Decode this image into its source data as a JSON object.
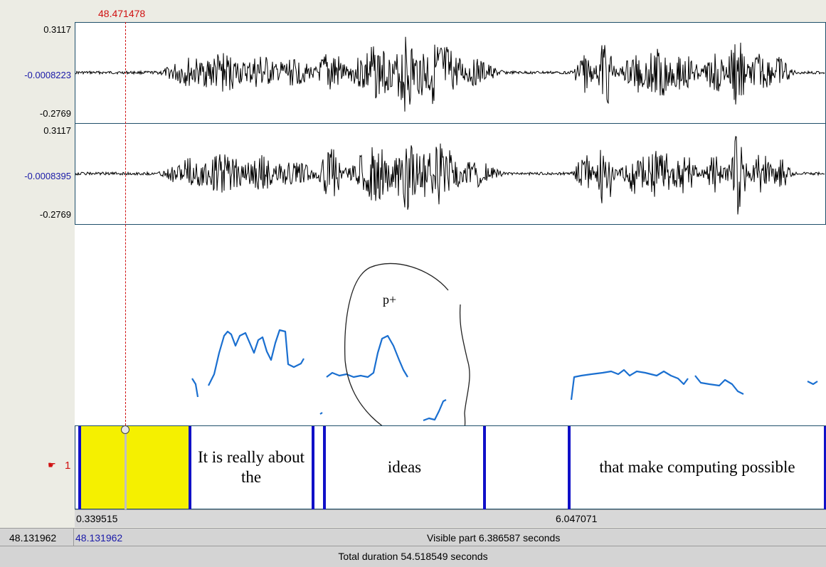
{
  "cursor": {
    "time_label": "48.471478"
  },
  "channels": [
    {
      "max": "0.3117",
      "mid": "-0.0008223",
      "min": "-0.2769"
    },
    {
      "max": "0.3117",
      "mid": "-0.0008395",
      "min": "-0.2769"
    }
  ],
  "pitch": {
    "annotation": "p+"
  },
  "tier": {
    "number": "1",
    "intervals": [
      {
        "text": ""
      },
      {
        "text": "It is really about the"
      },
      {
        "text": ""
      },
      {
        "text": "ideas"
      },
      {
        "text": ""
      },
      {
        "text": "that make computing possible"
      }
    ]
  },
  "ruler": {
    "left_label": "0.339515",
    "right_label": "6.047071"
  },
  "status": {
    "window_start": "48.131962",
    "window_start_blue": "48.131962",
    "visible": "Visible part 6.386587 seconds",
    "total": "Total duration 54.518549 seconds"
  },
  "colors": {
    "cursor": "#d01010",
    "pitch": "#1a6fd0",
    "boundary": "#1010c8",
    "selection": "#f5f000",
    "axis_mid": "#1a1aa8"
  }
}
